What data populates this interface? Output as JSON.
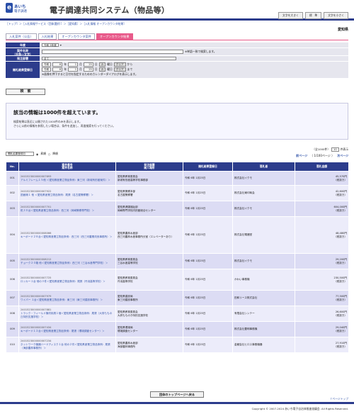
{
  "header": {
    "logo_mark": "e",
    "logo_line1": "あいち",
    "logo_line2": "電子調達",
    "system_name": "電子調達共同システム（物品等）",
    "buttons": [
      "文字を大きく",
      "標　準",
      "文字を小さく"
    ]
  },
  "breadcrumb": "［トップ］＞［入札情報サービス（団体選択）］＞［愛知県］＞［入札情報 オープンカウンタ結果］",
  "prefecture": "愛知県",
  "tabs": [
    "入札案件（公告）",
    "入札結果",
    "オープンカウンタ案件",
    "オープンカウンタ結果"
  ],
  "form": {
    "year_label": "年度",
    "year_value": "令和 5年度",
    "name_label": "案件名称\n（全角一文字）",
    "name_hint": "※単語一致で検索します。",
    "org_label": "発注部署",
    "org_value": "全て",
    "date_label": "開札結果登録日",
    "from": {
      "era": "令和",
      "y": "6",
      "m": "1",
      "d": "25",
      "cal": "カ",
      "day": "曜日",
      "clear": "クリア",
      "suffix": "から"
    },
    "to": {
      "era": "令和",
      "y": "6",
      "m": "1",
      "d": "25",
      "cal": "カ",
      "day": "曜日",
      "clear": "クリア",
      "suffix": "まで"
    },
    "note": "※画像を押下すると日付を指定するためのカレンダーダイアログを表示します。",
    "search": "検　索"
  },
  "message": {
    "title": "該当の情報は1000件を超えています。",
    "line1": "検索結果は直近に公開された1000件のみを表示します。",
    "line2": "さらに以前の情報を参照したい場合は、条件を追加し、再度検索を行ってください。"
  },
  "controls": {
    "sort": "開札結果登録日",
    "asc": "昇順",
    "desc": "降順",
    "count": "（全1000件）",
    "per_page": "10",
    "per_page_suffix": "件表示",
    "prev": "前ページ",
    "pages": "（ 1/100ページ ）",
    "next": "次ページ"
  },
  "table": {
    "headers": [
      "No.",
      "案件番号\n案件名称",
      "発注部署\n納入場所",
      "開札結果登録日",
      "落札者",
      "落札金額"
    ],
    "rows": [
      {
        "no": "001",
        "id": "2401523000000007693",
        "name": "アルミフレーム１５他 ＜愛知県産業立物品条例：東三河（新城有形館案件）＞",
        "org": "愛知県教育委員会",
        "place": "新城有形館高等学校事務部",
        "date": "令和 6年 1月25日",
        "winner": "株式会社イクモ",
        "amount": "45,570円",
        "tax": "（税抜き）"
      },
      {
        "no": "002",
        "id": "2401523000000007922",
        "name": "図面様１ 他 ＜愛知県産業立物品条例：尾張（名古屋警察署）＞",
        "org": "愛知県警察本部",
        "place": "名古屋警察署",
        "date": "令和 6年 1月25日",
        "winner": "株式会社東印商会",
        "amount": "42,600円",
        "tax": "（税抜き）"
      },
      {
        "no": "003",
        "id": "2401523000000007701",
        "name": "机３０台＜愛知県産業立物品条例：西三河（岡崎警察専門校）＞",
        "org": "愛知県健康福祉部",
        "place": "岡崎専門学校内別館総合センター",
        "date": "令和 6年 1月25日",
        "winner": "株式会社イクモ",
        "amount": "604,000円",
        "tax": "（税抜き）"
      },
      {
        "no": "004",
        "id": "2401523000000008066",
        "name": "キーボード２８台＜愛知県産業立物品条例：西三河（西三河農業改良事務所）＞",
        "org": "愛知県農林水産部",
        "place": "西三河農林水産事務所分室（エレベーターあり）",
        "date": "令和 6年 1月25日",
        "winner": "株式会社電器堂",
        "amount": "48,480円",
        "tax": "（税抜き）"
      },
      {
        "no": "005",
        "id": "2401523000000008212",
        "name": "チョーク２０箱 他＜愛知県産業立物品条例：西三河（三谷水産専門学校）＞",
        "org": "愛知県教育委員会",
        "place": "三谷水産高等学校",
        "date": "令和 6年 1月25日",
        "winner": "株式会社イクモ",
        "amount": "29,200円",
        "tax": "（税抜き）"
      },
      {
        "no": "006",
        "id": "2401523000000007725",
        "name": "ロッカー１台 他の３件＜愛知県産業立物品条例：尾張（丹羽高等学校）＞",
        "org": "愛知県教育委員会",
        "place": "丹羽高等学校",
        "date": "令和 6年 1月25日",
        "winner": "かわい事務機",
        "amount": "230,500円",
        "tax": "（税抜き）"
      },
      {
        "no": "007",
        "id": "2401523000000007979",
        "name": "ワイパー １台＜愛知県産業立物品条例：東三河（東三河建設事務所）＞",
        "org": "愛知県建設局",
        "place": "東三河建設事務所",
        "date": "令和 6年 1月25日",
        "winner": "田和リース株式会社",
        "amount": "77,500円",
        "tax": "（税抜き）"
      },
      {
        "no": "008",
        "id": "2401523000000007881",
        "name": "トラック・フィールド機材用具１個＜愛知県産業立物品条例：尾張（大府ももの丘特別支援学校）＞",
        "org": "愛知県教育委員会",
        "place": "大府もものき特別支援学校",
        "date": "令和 6年 1月25日",
        "winner": "有限会社シンテー",
        "amount": "26,600円",
        "tax": "（税抜き）"
      },
      {
        "no": "009",
        "id": "2401523000000007434",
        "name": "キーボード１２台＜愛知県産業立物品条例：尾張（環境調査センター）＞",
        "org": "愛知県環境局",
        "place": "環境調査センター",
        "date": "令和 6年 1月25日",
        "winner": "株式会社豊明事務機",
        "amount": "29,040円",
        "tax": "（税抜き）"
      },
      {
        "no": "010",
        "id": "2401523000000007234",
        "name": "ネットワーク機器ハードディスク１台 他の２件＜愛知県産業立物品条例：尾張（海部農林事務所）＞",
        "org": "愛知県農林水産部",
        "place": "海部農林事務所",
        "date": "令和 6年 1月25日",
        "winner": "金鯱会社ヒロス事務機器",
        "amount": "27,910円",
        "tax": "（税抜き）"
      }
    ]
  },
  "footer": {
    "top_button": "団体のトップページへ戻る",
    "page_top": "↑ページトップ",
    "copyright": "Copyright © 2007-2024 あいち電子自治体推進協議会. All Rights Reserved."
  }
}
